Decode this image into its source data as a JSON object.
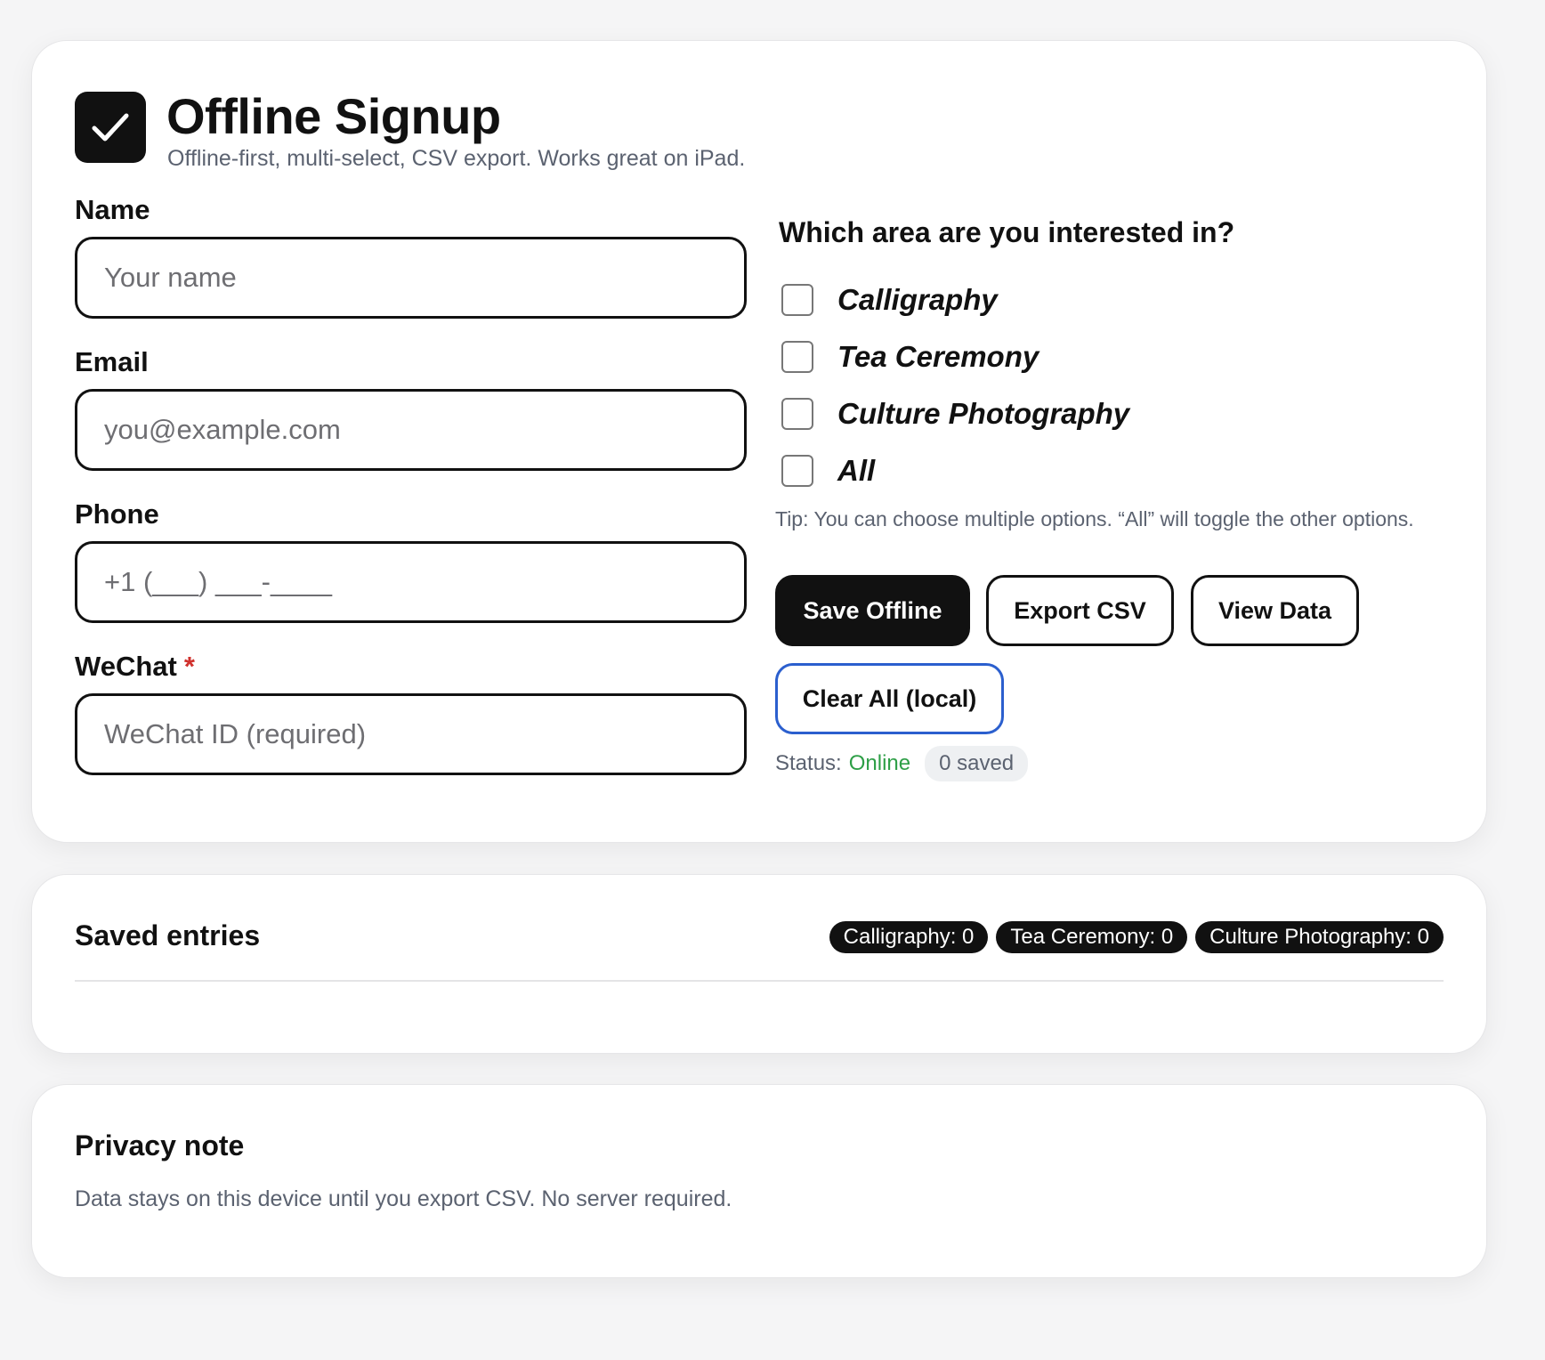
{
  "header": {
    "title": "Offline Signup",
    "subtitle": "Offline-first, multi-select, CSV export. Works great on iPad."
  },
  "form": {
    "name": {
      "label": "Name",
      "placeholder": "Your name",
      "value": ""
    },
    "email": {
      "label": "Email",
      "placeholder": "you@example.com",
      "value": ""
    },
    "phone": {
      "label": "Phone",
      "placeholder": "+1 (___) ___-____",
      "value": ""
    },
    "wechat": {
      "label": "WeChat",
      "required_mark": "*",
      "placeholder": "WeChat ID (required)",
      "value": ""
    }
  },
  "interests": {
    "question": "Which area are you interested in?",
    "options": [
      {
        "label": "Calligraphy",
        "checked": false
      },
      {
        "label": "Tea Ceremony",
        "checked": false
      },
      {
        "label": "Culture Photography",
        "checked": false
      },
      {
        "label": "All",
        "checked": false
      }
    ],
    "tip": "Tip: You can choose multiple options. “All” will toggle the other options."
  },
  "actions": {
    "save": "Save Offline",
    "export": "Export CSV",
    "view": "View Data",
    "clear": "Clear All (local)"
  },
  "status": {
    "label": "Status:",
    "value": "Online",
    "saved": "0 saved"
  },
  "saved_entries": {
    "title": "Saved entries",
    "counts": [
      "Calligraphy: 0",
      "Tea Ceremony: 0",
      "Culture Photography: 0"
    ]
  },
  "privacy": {
    "title": "Privacy note",
    "text": "Data stays on this device until you export CSV. No server required."
  },
  "colors": {
    "accent": "#111111",
    "online": "#2e9f47",
    "required": "#d0312d",
    "focus_outline": "#2b5fce"
  },
  "icons": {
    "logo": "checkmark-icon"
  }
}
